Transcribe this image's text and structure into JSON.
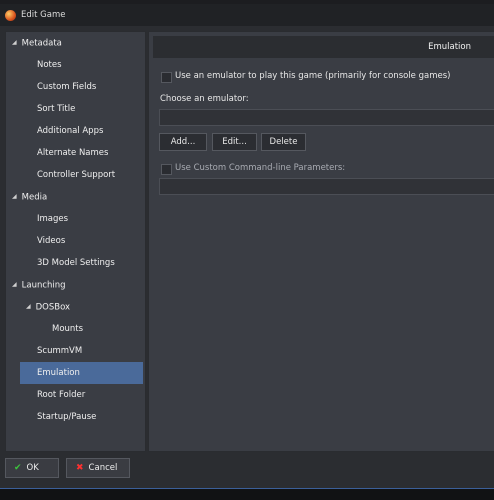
{
  "window": {
    "title": "Edit Game"
  },
  "tree": {
    "metadata": {
      "label": "Metadata",
      "children": [
        "Notes",
        "Custom Fields",
        "Sort Title",
        "Additional Apps",
        "Alternate Names",
        "Controller Support"
      ]
    },
    "media": {
      "label": "Media",
      "children": [
        "Images",
        "Videos",
        "3D Model Settings"
      ]
    },
    "launching": {
      "label": "Launching",
      "dosbox": "DOSBox",
      "mounts": "Mounts",
      "scummvm": "ScummVM",
      "emulation": "Emulation",
      "root_folder": "Root Folder",
      "startup_pause": "Startup/Pause"
    }
  },
  "selected_item": "Emulation",
  "emulation": {
    "title": "Emulation",
    "use_emulator_label": "Use an emulator to play this game (primarily for console games)",
    "use_emulator_checked": false,
    "choose_label": "Choose an emulator:",
    "emulator_value": "",
    "add_label": "Add...",
    "edit_label": "Edit...",
    "delete_label": "Delete",
    "custom_params_label": "Use Custom Command-line Parameters:",
    "custom_params_checked": false,
    "custom_params_value": ""
  },
  "footer": {
    "ok_label": "OK",
    "cancel_label": "Cancel"
  },
  "icons": {
    "app": "launchbox-icon",
    "expand": "triangle-expanded-icon",
    "ok": "checkmark-icon",
    "cancel": "x-icon"
  },
  "colors": {
    "selection": "#4a6a9a",
    "ok_check": "#3cc43c",
    "cancel_x": "#ff3030"
  }
}
